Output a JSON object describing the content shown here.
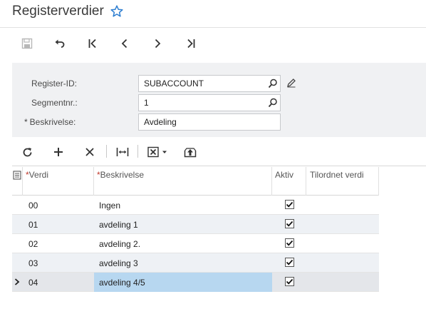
{
  "page": {
    "title": "Registerverdier"
  },
  "icons": {
    "favorite": "star-outline-icon",
    "save": "save-icon",
    "undo": "undo-icon",
    "first": "first-record-icon",
    "previous": "previous-record-icon",
    "next": "next-record-icon",
    "last": "last-record-icon",
    "lookup": "magnifier-icon",
    "edit": "pencil-icon",
    "refresh": "refresh-icon",
    "add": "plus-icon",
    "delete": "x-icon",
    "fit": "fit-columns-icon",
    "excel": "excel-export-icon",
    "upload": "upload-icon"
  },
  "colors": {
    "accent": "#2f7fd1",
    "selected_cell": "#b7d7f0",
    "form_bg": "#f0f1f3",
    "required": "#c0392b"
  },
  "form": {
    "register_id": {
      "label": "Register-ID:",
      "value": "SUBACCOUNT"
    },
    "segment": {
      "label": "Segmentnr.:",
      "value": "1"
    },
    "description": {
      "required_mark": "*",
      "label": "Beskrivelse:",
      "value": "Avdeling"
    }
  },
  "grid": {
    "columns": {
      "value": {
        "required_mark": "*",
        "label": "Verdi"
      },
      "description": {
        "required_mark": "*",
        "label": "Beskrivelse"
      },
      "active": {
        "label": "Aktiv"
      },
      "assigned": {
        "label": "Tilordnet verdi"
      }
    },
    "rows": [
      {
        "value": "00",
        "description": "Ingen",
        "active": true
      },
      {
        "value": "01",
        "description": "avdeling 1",
        "active": true
      },
      {
        "value": "02",
        "description": "avdeling 2.",
        "active": true
      },
      {
        "value": "03",
        "description": "avdeling 3",
        "active": true
      },
      {
        "value": "04",
        "description": "avdeling 4/5",
        "active": true
      }
    ],
    "selected_row": 4
  }
}
